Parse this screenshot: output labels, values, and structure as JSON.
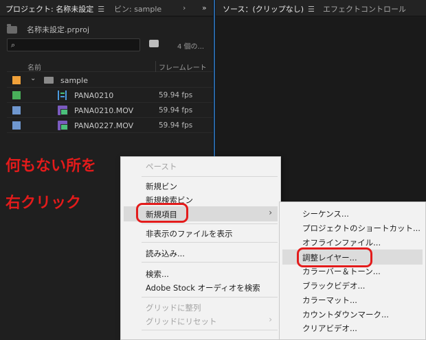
{
  "tabs_left": {
    "project_tab": "プロジェクト: 名称未設定",
    "project_menu": "☰",
    "bin_tab": "ビン: sample",
    "overflow": "›",
    "expand": "»"
  },
  "tabs_right": {
    "source_tab": "ソース：(クリップなし)",
    "source_menu": "☰",
    "effect_tab": "エフェクトコントロール"
  },
  "project": {
    "filename": "名称未設定.prproj",
    "search_placeholder": "",
    "item_count": "4 個の..."
  },
  "columns": {
    "name": "名前",
    "framerate": "フレームレート"
  },
  "rows": [
    {
      "name": "sample",
      "fps": "",
      "color": "#f0a13a",
      "kind": "folder"
    },
    {
      "name": "PANA0210",
      "fps": "59.94 fps",
      "color": "#49b05a",
      "kind": "sequence"
    },
    {
      "name": "PANA0210.MOV",
      "fps": "59.94 fps",
      "color": "#6f97cf",
      "kind": "clip"
    },
    {
      "name": "PANA0227.MOV",
      "fps": "59.94 fps",
      "color": "#6f97cf",
      "kind": "clip"
    }
  ],
  "annotation": {
    "line1": "何もない所を",
    "line2": "右クリック"
  },
  "context_menu": {
    "paste": "ペースト",
    "new_bin": "新規ビン",
    "new_search_bin": "新規検索ビン",
    "new_item": "新規項目",
    "show_hidden": "非表示のファイルを表示",
    "import": "読み込み...",
    "find": "検索...",
    "adobe_stock": "Adobe Stock オーディオを検索",
    "align_grid": "グリッドに整列",
    "reset_grid": "グリッドにリセット",
    "more": "…"
  },
  "submenu": {
    "sequence": "シーケンス...",
    "project_shortcut": "プロジェクトのショートカット...",
    "offline_file": "オフラインファイル...",
    "adjustment_layer": "調整レイヤー...",
    "bars_tone": "カラーバー＆トーン...",
    "black_video": "ブラックビデオ...",
    "color_matte": "カラーマット...",
    "countdown": "カウントダウンマーク...",
    "clear_video": "クリアビデオ..."
  }
}
